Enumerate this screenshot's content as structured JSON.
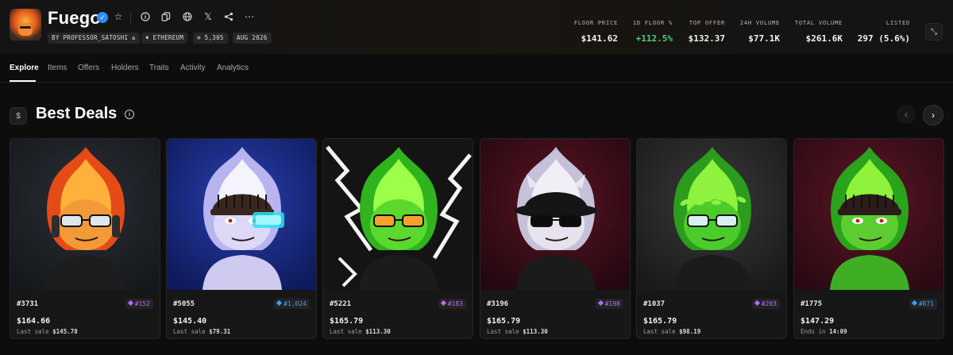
{
  "collection": {
    "name": "Fuego",
    "creator": "BY PROFESSOR_SATOSHI",
    "chain": "ETHEREUM",
    "supply": "5,305",
    "date": "AUG 2026"
  },
  "stats": [
    {
      "label": "FLOOR PRICE",
      "value": "$141.62",
      "tone": "normal"
    },
    {
      "label": "1D FLOOR %",
      "value": "+112.5%",
      "tone": "green"
    },
    {
      "label": "TOP OFFER",
      "value": "$132.37",
      "tone": "normal"
    },
    {
      "label": "24H VOLUME",
      "value": "$77.1K",
      "tone": "normal"
    },
    {
      "label": "TOTAL VOLUME",
      "value": "$261.6K",
      "tone": "normal"
    },
    {
      "label": "LISTED",
      "value": "297 (5.6%)",
      "tone": "normal"
    }
  ],
  "tabs": [
    "Explore",
    "Items",
    "Offers",
    "Holders",
    "Traits",
    "Activity",
    "Analytics"
  ],
  "active_tab": "Explore",
  "section": {
    "icon_glyph": "$",
    "title": "Best Deals"
  },
  "colors": {
    "rank_purple": "#b86bff",
    "rank_blue": "#3ea3ff",
    "green_up": "#4ad07a"
  },
  "cards": [
    {
      "id": "#3731",
      "rank": "#152",
      "rank_color": "purple",
      "price": "$164.66",
      "sub_label": "Last sale",
      "sub_value": "$145.78",
      "art": "orange-fire"
    },
    {
      "id": "#5055",
      "rank": "#1,024",
      "rank_color": "blue",
      "price": "$145.40",
      "sub_label": "Last sale",
      "sub_value": "$79.31",
      "art": "white-fire"
    },
    {
      "id": "#5221",
      "rank": "#183",
      "rank_color": "purple",
      "price": "$165.79",
      "sub_label": "Last sale",
      "sub_value": "$113.30",
      "art": "green-lightning"
    },
    {
      "id": "#3196",
      "rank": "#198",
      "rank_color": "purple",
      "price": "$165.79",
      "sub_label": "Last sale",
      "sub_value": "$113.30",
      "art": "white-bucket-hat"
    },
    {
      "id": "#1037",
      "rank": "#203",
      "rank_color": "purple",
      "price": "$165.79",
      "sub_label": "Last sale",
      "sub_value": "$98.19",
      "art": "green-laurel"
    },
    {
      "id": "#1775",
      "rank": "#871",
      "rank_color": "blue",
      "price": "$147.29",
      "sub_label": "Ends in",
      "sub_value": "14:09",
      "art": "green-beanie"
    }
  ]
}
